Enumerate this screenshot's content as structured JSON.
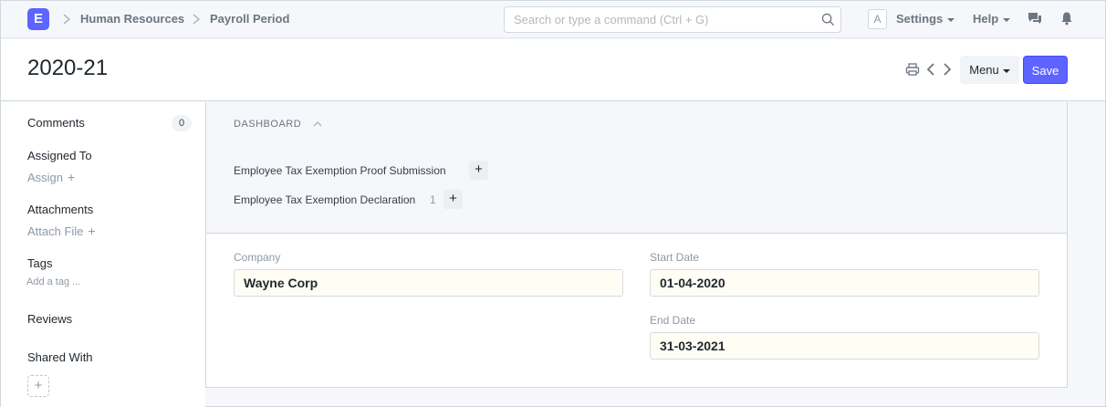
{
  "navbar": {
    "logo_letter": "E",
    "breadcrumbs": [
      "Human Resources",
      "Payroll Period"
    ],
    "search_placeholder": "Search or type a command (Ctrl + G)",
    "avatar_letter": "A",
    "settings_label": "Settings",
    "help_label": "Help"
  },
  "page": {
    "title": "2020-21",
    "menu_label": "Menu",
    "save_label": "Save"
  },
  "sidebar": {
    "comments_label": "Comments",
    "comments_count": "0",
    "assigned_label": "Assigned To",
    "assign_action": "Assign",
    "attachments_label": "Attachments",
    "attach_action": "Attach File",
    "tags_label": "Tags",
    "add_tag": "Add a tag ...",
    "reviews_label": "Reviews",
    "shared_label": "Shared With",
    "plus": "+"
  },
  "dashboard": {
    "heading": "DASHBOARD",
    "links": [
      {
        "label": "Employee Tax Exemption Proof Submission",
        "count": ""
      },
      {
        "label": "Employee Tax Exemption Declaration",
        "count": "1"
      }
    ],
    "add_symbol": "+"
  },
  "form": {
    "company_label": "Company",
    "company_value": "Wayne Corp",
    "start_label": "Start Date",
    "start_value": "01-04-2020",
    "end_label": "End Date",
    "end_value": "31-03-2021"
  },
  "colors": {
    "accent": "#5e64ff",
    "input_bg": "#fffdf4"
  },
  "icons": [
    "search-icon",
    "chevron-right-icon",
    "chat-icon",
    "bell-icon",
    "print-icon",
    "chevron-left-icon",
    "chevron-up-icon",
    "plus-icon"
  ]
}
